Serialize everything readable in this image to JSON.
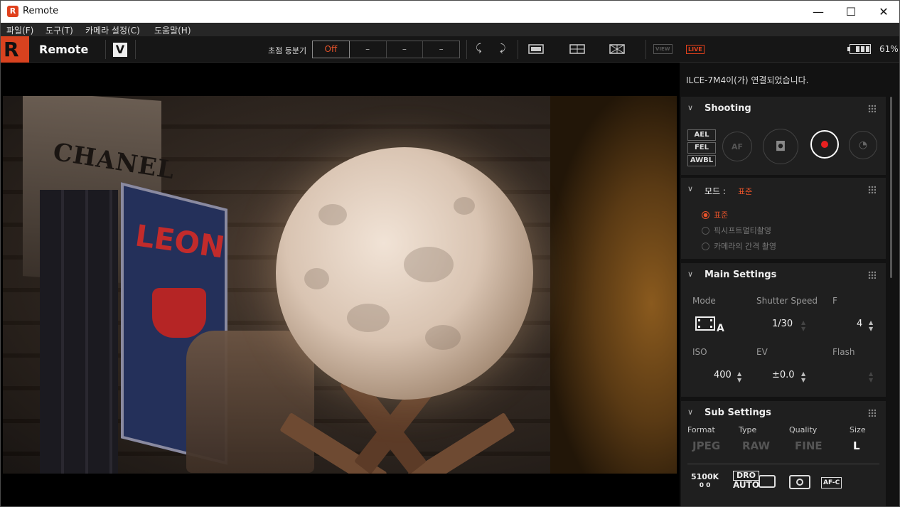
{
  "window": {
    "title": "Remote",
    "app_icon_letter": "R",
    "minimize": "—",
    "maximize": "☐",
    "close": "✕"
  },
  "menu": [
    "파일(F)",
    "도구(T)",
    "카메라 설정(C)",
    "도움말(H)"
  ],
  "toolbar": {
    "app_name": "Remote",
    "badge": "V",
    "focus_bracket_label": "초점 등분기",
    "focus_options": [
      "Off",
      "–",
      "–",
      "–"
    ],
    "view_label": "VIEW",
    "live_label": "LIVE",
    "battery_pct": "61%",
    "battery_level": 0.61
  },
  "status": {
    "message": "ILCE-7M4이(가) 연결되었습니다."
  },
  "shooting": {
    "title": "Shooting",
    "locks": [
      "AEL",
      "FEL",
      "AWBL"
    ],
    "af_label": "AF"
  },
  "mode_section": {
    "title": "모드 :",
    "current": "표준",
    "options": [
      {
        "label": "표준",
        "selected": true
      },
      {
        "label": "픽시프트멀티촬영",
        "selected": false
      },
      {
        "label": "카메라의 간격 촬영",
        "selected": false
      }
    ]
  },
  "main_settings": {
    "title": "Main Settings",
    "mode_label": "Mode",
    "mode_value": "A",
    "shutter_label": "Shutter Speed",
    "shutter_value": "1/30",
    "f_label": "F",
    "f_value": "4",
    "iso_label": "ISO",
    "iso_value": "400",
    "ev_label": "EV",
    "ev_value": "±0.0",
    "flash_label": "Flash"
  },
  "sub_settings": {
    "title": "Sub Settings",
    "format_label": "Format",
    "format_value": "JPEG",
    "type_label": "Type",
    "type_value": "RAW",
    "quality_label": "Quality",
    "quality_value": "FINE",
    "size_label": "Size",
    "size_value": "L",
    "wb_value": "5100K",
    "wb_sub": "0   0",
    "dro_top": "DRO",
    "dro_bottom": "AUTO",
    "af_mode": "AF-C"
  },
  "viewer_text": {
    "book1": "CHANEL",
    "book2": "LEON"
  }
}
